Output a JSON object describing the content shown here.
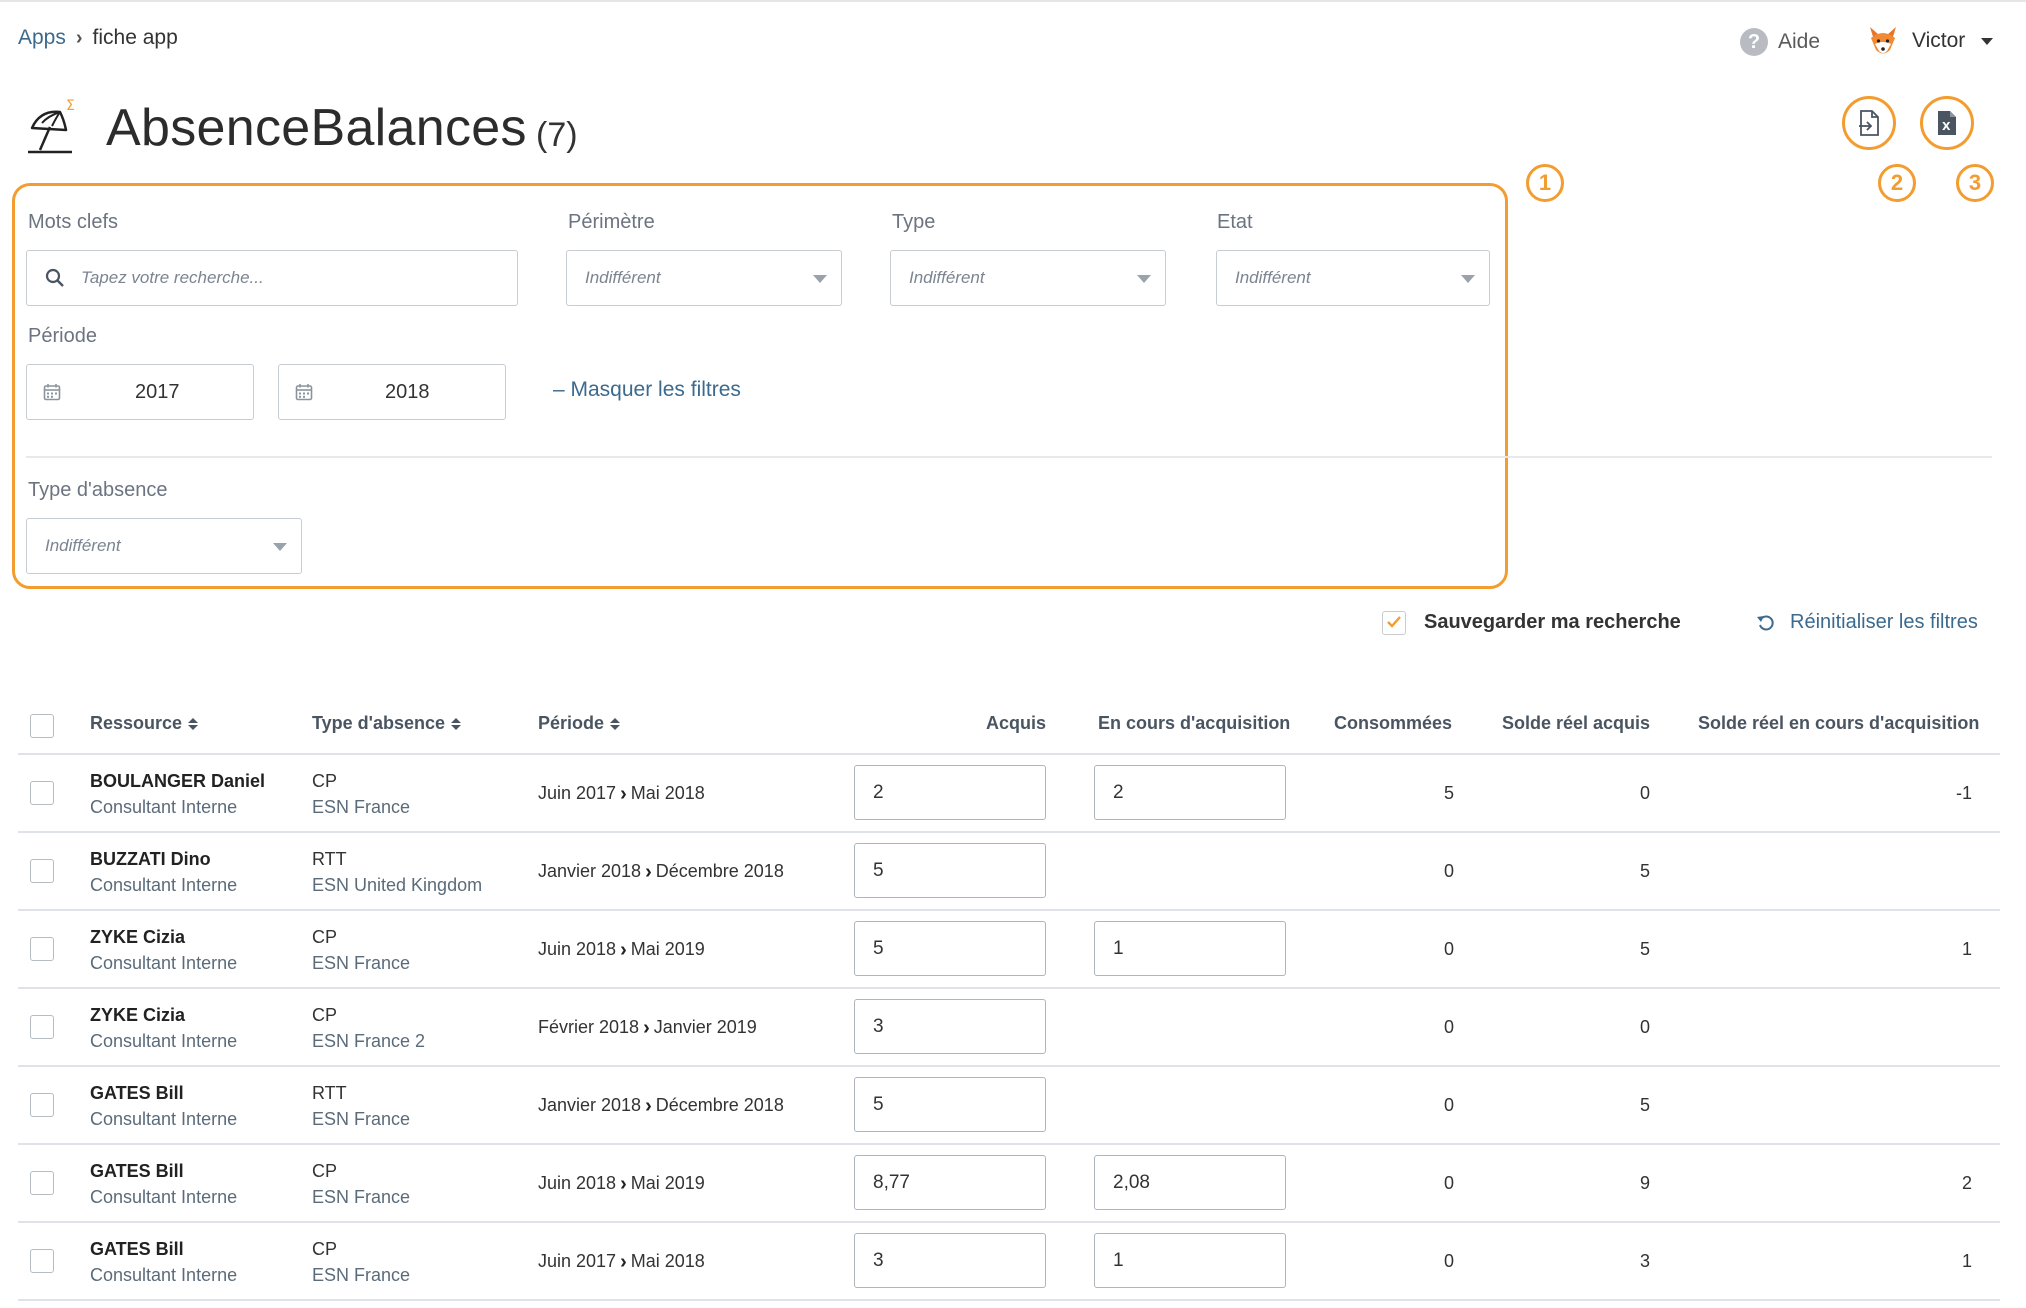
{
  "breadcrumb": {
    "root": "Apps",
    "current": "fiche app"
  },
  "header": {
    "help_label": "Aide",
    "user_name": "Victor"
  },
  "page": {
    "title": "AbsenceBalances",
    "count": "(7)"
  },
  "annotations": {
    "filters": "1",
    "import": "2",
    "export": "3"
  },
  "accent_color": "#f39c2f",
  "filters": {
    "keywords": {
      "label": "Mots clefs",
      "placeholder": "Tapez votre recherche..."
    },
    "perimeter": {
      "label": "Périmètre",
      "value": "Indifférent"
    },
    "type": {
      "label": "Type",
      "value": "Indifférent"
    },
    "state": {
      "label": "Etat",
      "value": "Indifférent"
    },
    "period": {
      "label": "Période",
      "from": "2017",
      "to": "2018"
    },
    "hide_filters": "– Masquer les filtres",
    "absence_type": {
      "label": "Type d'absence",
      "value": "Indifférent"
    }
  },
  "save_search": "Sauvegarder ma recherche",
  "reset_filters": "Réinitialiser les filtres",
  "table": {
    "columns": {
      "resource": "Ressource",
      "absence_type": "Type d'absence",
      "period": "Période",
      "acquired": "Acquis",
      "acquiring": "En cours d'acquisition",
      "consumed": "Consommées",
      "real_balance_acquired": "Solde réel acquis",
      "real_balance_acquiring": "Solde réel en cours d'acquisition"
    },
    "rows": [
      {
        "name": "BOULANGER Daniel",
        "role": "Consultant Interne",
        "type": "CP",
        "entity": "ESN France",
        "period_start": "Juin 2017",
        "period_end": "Mai 2018",
        "acquired": "2",
        "acquiring": "2",
        "consumed": "5",
        "balance_acquired": "0",
        "balance_acquiring": "-1"
      },
      {
        "name": "BUZZATI Dino",
        "role": "Consultant Interne",
        "type": "RTT",
        "entity": "ESN United Kingdom",
        "period_start": "Janvier 2018",
        "period_end": "Décembre 2018",
        "acquired": "5",
        "acquiring": null,
        "consumed": "0",
        "balance_acquired": "5",
        "balance_acquiring": ""
      },
      {
        "name": "ZYKE Cizia",
        "role": "Consultant Interne",
        "type": "CP",
        "entity": "ESN France",
        "period_start": "Juin 2018",
        "period_end": "Mai 2019",
        "acquired": "5",
        "acquiring": "1",
        "consumed": "0",
        "balance_acquired": "5",
        "balance_acquiring": "1"
      },
      {
        "name": "ZYKE Cizia",
        "role": "Consultant Interne",
        "type": "CP",
        "entity": "ESN France 2",
        "period_start": "Février 2018",
        "period_end": "Janvier 2019",
        "acquired": "3",
        "acquiring": null,
        "consumed": "0",
        "balance_acquired": "0",
        "balance_acquiring": ""
      },
      {
        "name": "GATES Bill",
        "role": "Consultant Interne",
        "type": "RTT",
        "entity": "ESN France",
        "period_start": "Janvier 2018",
        "period_end": "Décembre 2018",
        "acquired": "5",
        "acquiring": null,
        "consumed": "0",
        "balance_acquired": "5",
        "balance_acquiring": ""
      },
      {
        "name": "GATES Bill",
        "role": "Consultant Interne",
        "type": "CP",
        "entity": "ESN France",
        "period_start": "Juin 2018",
        "period_end": "Mai 2019",
        "acquired": "8,77",
        "acquiring": "2,08",
        "consumed": "0",
        "balance_acquired": "9",
        "balance_acquiring": "2"
      },
      {
        "name": "GATES Bill",
        "role": "Consultant Interne",
        "type": "CP",
        "entity": "ESN France",
        "period_start": "Juin 2017",
        "period_end": "Mai 2018",
        "acquired": "3",
        "acquiring": "1",
        "consumed": "0",
        "balance_acquired": "3",
        "balance_acquiring": "1"
      }
    ]
  }
}
